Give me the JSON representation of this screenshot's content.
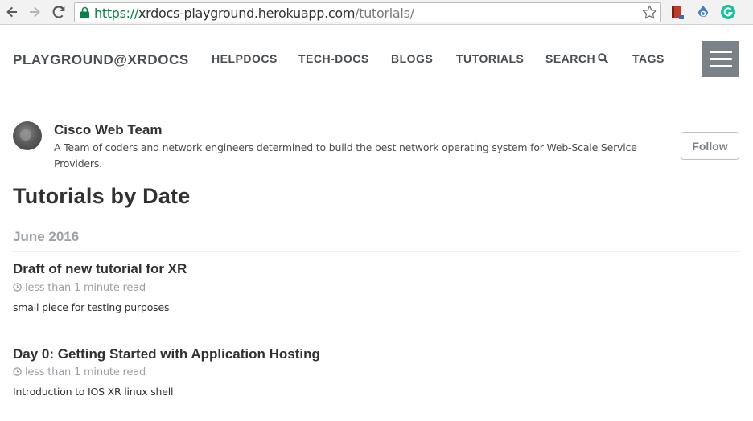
{
  "browser": {
    "url_scheme": "https://",
    "url_host": "xrdocs-playground.herokuapp.com",
    "url_path": "/tutorials/"
  },
  "header": {
    "site_title": "PLAYGROUND@XRDOCS",
    "nav": {
      "helpdocs": "HELPDOCS",
      "techdocs": "TECH-DOCS",
      "blogs": "BLOGS",
      "tutorials": "TUTORIALS",
      "search": "SEARCH",
      "tags": "TAGS"
    }
  },
  "author": {
    "name": "Cisco Web Team",
    "bio": "A Team of coders and network engineers determined to build the best network operating system for Web-Scale Service Providers.",
    "follow_label": "Follow"
  },
  "page": {
    "title": "Tutorials by Date",
    "archive_group": "June 2016"
  },
  "posts": [
    {
      "title": "Draft of new tutorial for XR",
      "read_time": "less than 1 minute read",
      "excerpt": "small piece for testing purposes"
    },
    {
      "title": "Day 0: Getting Started with Application Hosting",
      "read_time": "less than 1 minute read",
      "excerpt": "Introduction to IOS XR linux shell"
    }
  ],
  "colors": {
    "secure_green": "#0b8043",
    "menu_button_bg": "#7a8288",
    "muted_text": "#9ba1a6",
    "body_text": "#313131"
  }
}
